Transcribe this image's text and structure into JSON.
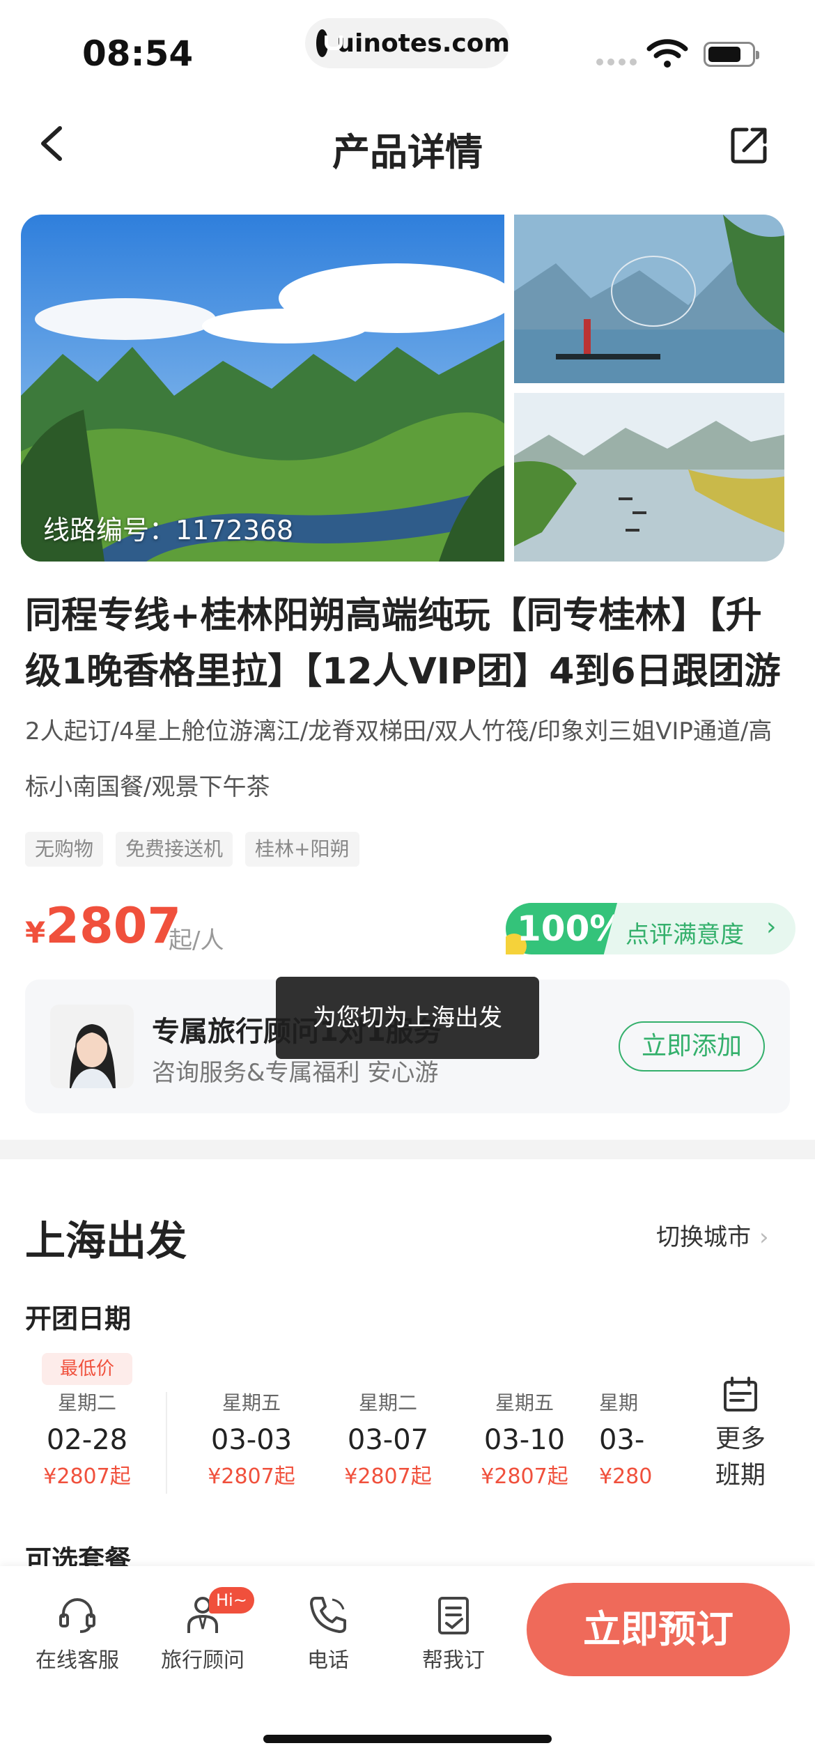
{
  "status_bar": {
    "time": "08:54",
    "url": "uinotes.com"
  },
  "nav": {
    "title": "产品详情"
  },
  "gallery": {
    "route_number": "线路编号：1172368"
  },
  "product": {
    "title": "同程专线+桂林阳朔高端纯玩【同专桂林】【升级1晚香格里拉】【12人VIP团】4到6日跟团游",
    "subtitle": "2人起订/4星上舱位游漓江/龙脊双梯田/双人竹筏/印象刘三姐VIP通道/高标小南国餐/观景下午茶",
    "tags": [
      "无购物",
      "免费接送机",
      "桂林+阳朔"
    ],
    "price_currency": "¥",
    "price": "2807",
    "price_unit": "起/人",
    "rating_value": "100%",
    "rating_label": "点评满意度"
  },
  "advisor": {
    "name": "专属旅行顾问1对1服务",
    "desc": "咨询服务&专属福利 安心游",
    "add_label": "立即添加"
  },
  "toast": "为您切为上海出发",
  "departure": {
    "title": "上海出发",
    "switch_city": "切换城市",
    "dates_title": "开团日期",
    "lowest_badge": "最低价",
    "dates": [
      {
        "week": "星期二",
        "day": "02-28",
        "price": "¥2807起"
      },
      {
        "week": "星期五",
        "day": "03-03",
        "price": "¥2807起"
      },
      {
        "week": "星期二",
        "day": "03-07",
        "price": "¥2807起"
      },
      {
        "week": "星期五",
        "day": "03-10",
        "price": "¥2807起"
      },
      {
        "week": "星期",
        "day": "03-",
        "price": "¥280"
      }
    ],
    "more_dates": "更多班期",
    "packages_title": "可选套餐"
  },
  "bottom_bar": {
    "items": [
      {
        "label": "在线客服",
        "icon": "headset-icon"
      },
      {
        "label": "旅行顾问",
        "icon": "advisor-icon",
        "badge": "Hi~"
      },
      {
        "label": "电话",
        "icon": "phone-icon"
      },
      {
        "label": "帮我订",
        "icon": "clipboard-icon"
      }
    ],
    "book_label": "立即预订"
  },
  "colors": {
    "accent": "#f0503c",
    "green": "#34b06c",
    "book_button": "#ef6a5a"
  }
}
